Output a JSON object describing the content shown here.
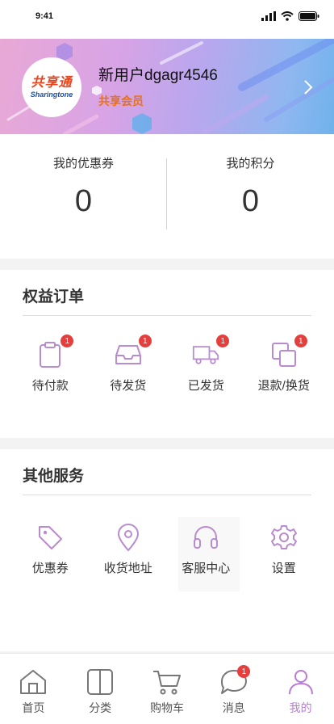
{
  "status_bar": {
    "time": "9:41"
  },
  "profile": {
    "logo_cn": "共享通",
    "logo_en": "Sharingtone",
    "username": "新用户dgagr4546",
    "member_level": "共享会员"
  },
  "stats": [
    {
      "label": "我的优惠券",
      "value": "0"
    },
    {
      "label": "我的积分",
      "value": "0"
    }
  ],
  "orders": {
    "title": "权益订单",
    "items": [
      {
        "label": "待付款",
        "badge": "1",
        "icon": "clipboard-icon"
      },
      {
        "label": "待发货",
        "badge": "1",
        "icon": "inbox-tray-icon"
      },
      {
        "label": "已发货",
        "badge": "1",
        "icon": "truck-icon"
      },
      {
        "label": "退款/换货",
        "badge": "1",
        "icon": "copy-squares-icon"
      }
    ]
  },
  "services": {
    "title": "其他服务",
    "items": [
      {
        "label": "优惠券",
        "icon": "tag-icon"
      },
      {
        "label": "收货地址",
        "icon": "location-pin-icon"
      },
      {
        "label": "客服中心",
        "icon": "headset-icon"
      },
      {
        "label": "设置",
        "icon": "gear-icon"
      }
    ]
  },
  "tabbar": [
    {
      "label": "首页",
      "icon": "home-icon"
    },
    {
      "label": "分类",
      "icon": "category-icon"
    },
    {
      "label": "购物车",
      "icon": "cart-icon"
    },
    {
      "label": "消息",
      "icon": "message-icon",
      "badge": "1"
    },
    {
      "label": "我的",
      "icon": "user-icon",
      "active": true
    }
  ],
  "colors": {
    "accent": "#b97bd6",
    "badge": "#e63d3d",
    "member": "#e8701d",
    "icon_stroke": "#b98bcf"
  }
}
